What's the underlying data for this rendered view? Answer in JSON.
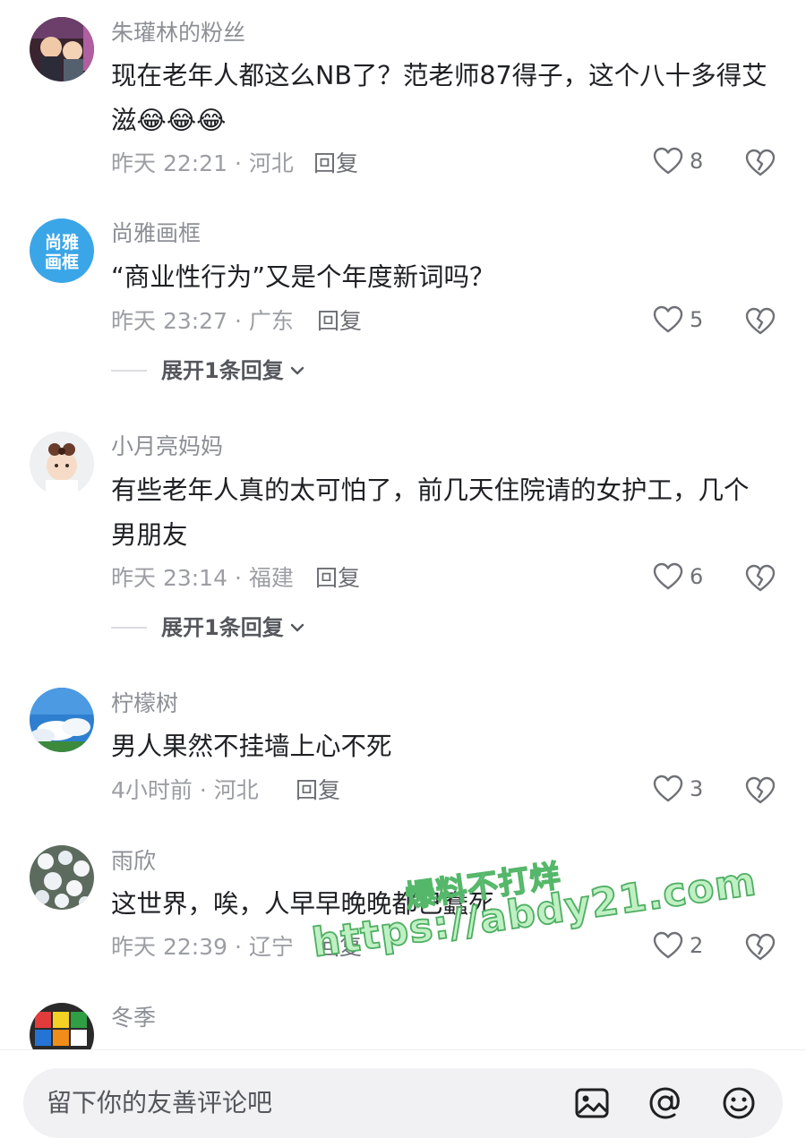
{
  "comments": [
    {
      "username": "朱瓘林的粉丝",
      "text": "现在老年人都这么NB了？范老师87得子，这个八十多得艾滋",
      "emoji": "😂😂😂",
      "time": "昨天 22:21 · 河北",
      "reply_label": "回复",
      "likes": "8"
    },
    {
      "username": "尚雅画框",
      "text": "“商业性行为”又是个年度新词吗？",
      "time": "昨天 23:27 · 广东",
      "reply_label": "回复",
      "likes": "5",
      "expand_label": "展开1条回复",
      "avatar_text": "尚雅画框"
    },
    {
      "username": "小月亮妈妈",
      "text": "有些老年人真的太可怕了，前几天住院请的女护工，几个男朋友",
      "time": "昨天 23:14 · 福建",
      "reply_label": "回复",
      "likes": "6",
      "expand_label": "展开1条回复"
    },
    {
      "username": "柠檬树",
      "text": "男人果然不挂墙上心不死",
      "time": "4小时前 · 河北",
      "reply_label": "回复",
      "likes": "3"
    },
    {
      "username": "雨欣",
      "text": "这世界，唉，人早早晚晚都已蠢死",
      "time": "昨天 22:39 · 辽宁",
      "reply_label": "回复",
      "likes": "2"
    },
    {
      "username": "冬季",
      "text": ""
    }
  ],
  "input": {
    "placeholder": "留下你的友善评论吧"
  },
  "watermark": {
    "line1": "爆料不打烊",
    "line2": "https://abdy21.com"
  },
  "icons": {
    "like": "heart-outline-icon",
    "dislike": "broken-heart-icon",
    "expand": "chevron-down-icon",
    "image": "image-icon",
    "mention": "at-icon",
    "emoji": "smiley-icon"
  }
}
